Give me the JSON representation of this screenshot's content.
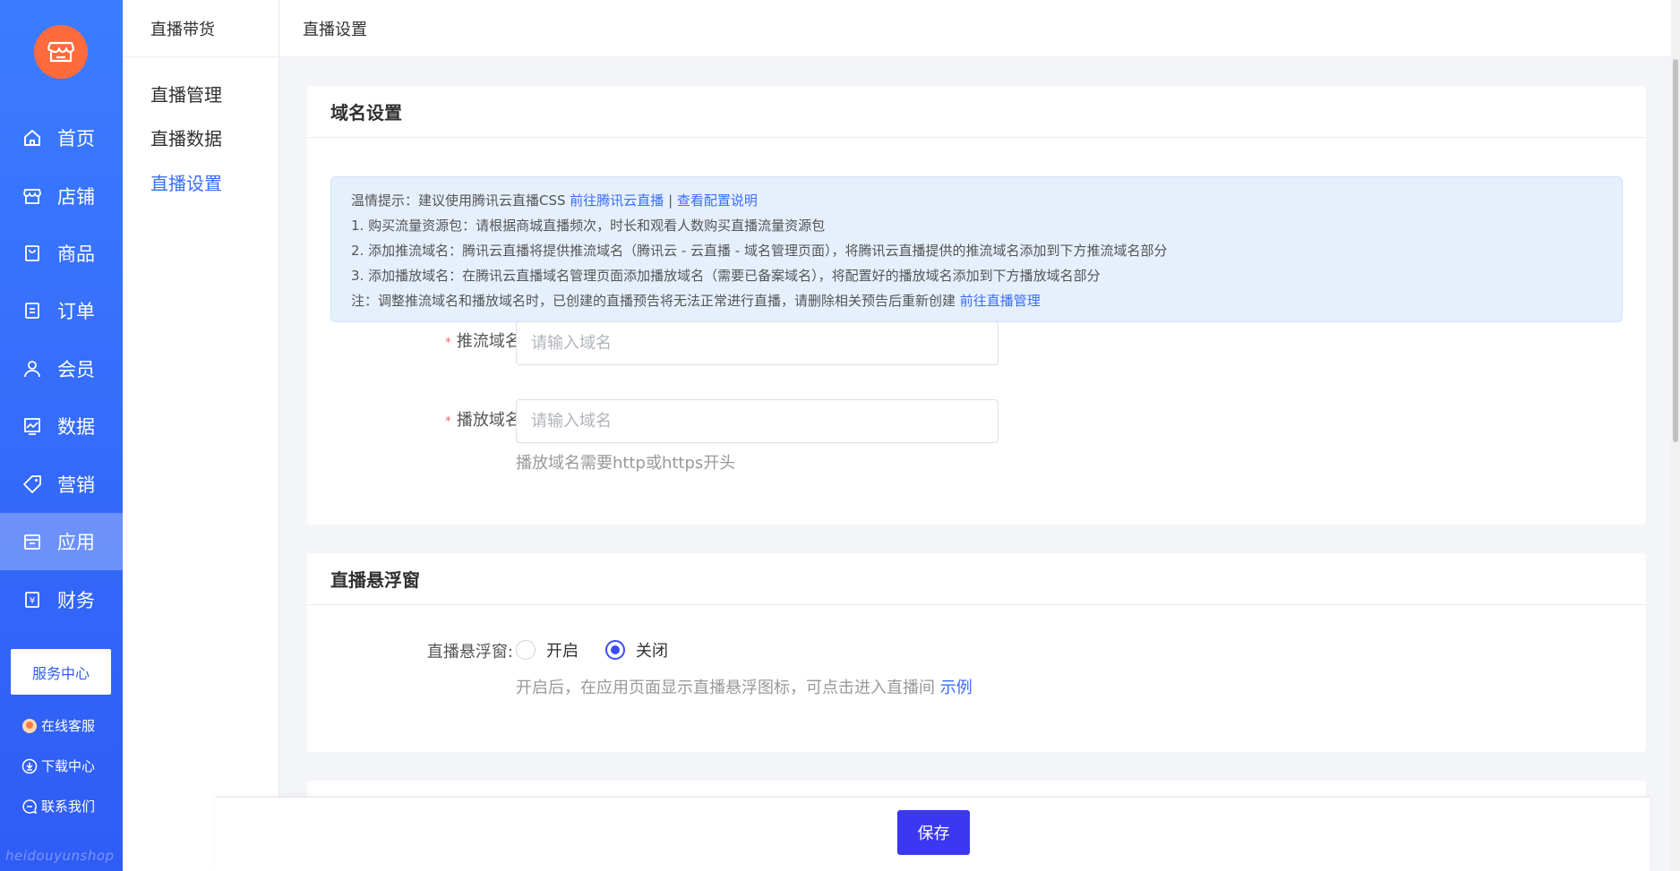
{
  "sidebar": {
    "items": [
      {
        "label": "首页",
        "icon": "home-icon"
      },
      {
        "label": "店铺",
        "icon": "store-icon"
      },
      {
        "label": "商品",
        "icon": "goods-icon"
      },
      {
        "label": "订单",
        "icon": "order-icon"
      },
      {
        "label": "会员",
        "icon": "user-icon"
      },
      {
        "label": "数据",
        "icon": "chart-icon"
      },
      {
        "label": "营销",
        "icon": "tag-icon"
      },
      {
        "label": "应用",
        "icon": "app-icon",
        "active": true
      },
      {
        "label": "财务",
        "icon": "finance-icon"
      }
    ],
    "service_center": "服务中心",
    "links": [
      {
        "label": "在线客服",
        "icon": "support-icon"
      },
      {
        "label": "下载中心",
        "icon": "download-icon"
      },
      {
        "label": "联系我们",
        "icon": "chat-icon"
      }
    ],
    "watermark": "heidouyunshop"
  },
  "subnav": {
    "title": "直播带货",
    "items": [
      {
        "label": "直播管理"
      },
      {
        "label": "直播数据"
      },
      {
        "label": "直播设置",
        "active": true
      }
    ]
  },
  "topbar": {
    "title": "直播设置"
  },
  "domain_section": {
    "title": "域名设置",
    "tip": {
      "line1_prefix": "温情提示：建议使用腾讯云直播CSS ",
      "line1_link1": "前往腾讯云直播",
      "line1_sep": " | ",
      "line1_link2": "查看配置说明",
      "line2": "1. 购买流量资源包：请根据商城直播频次，时长和观看人数购买直播流量资源包",
      "line3": "2. 添加推流域名：腾讯云直播将提供推流域名（腾讯云 - 云直播 - 域名管理页面），将腾讯云直播提供的推流域名添加到下方推流域名部分",
      "line4": "3. 添加播放域名：在腾讯云直播域名管理页面添加播放域名（需要已备案域名），将配置好的播放域名添加到下方播放域名部分",
      "line5_prefix": "注：调整推流域名和播放域名时，已创建的直播预告将无法正常进行直播，请删除相关预告后重新创建 ",
      "line5_link": "前往直播管理"
    },
    "push": {
      "required": "*",
      "label": "推流域名:",
      "placeholder": "请输入域名",
      "value": ""
    },
    "play": {
      "required": "*",
      "label": "播放域名:",
      "placeholder": "请输入域名",
      "value": "",
      "hint": "播放域名需要http或https开头"
    }
  },
  "float_section": {
    "title": "直播悬浮窗",
    "label": "直播悬浮窗:",
    "options": [
      {
        "label": "开启",
        "selected": false
      },
      {
        "label": "关闭",
        "selected": true
      }
    ],
    "hint": "开启后，在应用页面显示直播悬浮图标，可点击进入直播间 ",
    "hint_link": "示例"
  },
  "footer": {
    "save_label": "保存"
  },
  "colors": {
    "sidebar_top": "#3b7cff",
    "sidebar_bottom": "#2f5cf5",
    "logo": "#ff6b3d",
    "link": "#3a6cff",
    "save_button": "#3a38f0",
    "required": "#f56c6c",
    "tip_bg": "#e6f0fd"
  }
}
